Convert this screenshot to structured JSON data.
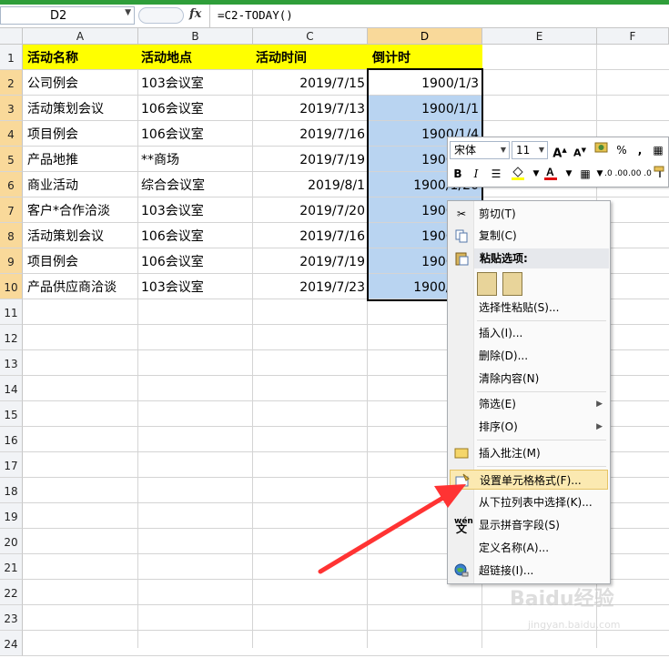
{
  "formula_bar": {
    "name_box": "D2",
    "fx": "fx",
    "formula": "=C2-TODAY()"
  },
  "columns": [
    "A",
    "B",
    "C",
    "D",
    "E",
    "F"
  ],
  "rows": [
    "1",
    "2",
    "3",
    "4",
    "5",
    "6",
    "7",
    "8",
    "9",
    "10",
    "11",
    "12",
    "13",
    "14",
    "15",
    "16",
    "17",
    "18",
    "19",
    "20",
    "21",
    "22",
    "23",
    "24"
  ],
  "headers": [
    "活动名称",
    "活动地点",
    "活动时间",
    "倒计时"
  ],
  "table": [
    [
      "公司例会",
      "103会议室",
      "2019/7/15",
      "1900/1/3"
    ],
    [
      "活动策划会议",
      "106会议室",
      "2019/7/13",
      "1900/1/1"
    ],
    [
      "项目例会",
      "106会议室",
      "2019/7/16",
      "1900/1/4"
    ],
    [
      "产品地推",
      "**商场",
      "2019/7/19",
      "1900/1/7"
    ],
    [
      "商业活动",
      "综合会议室",
      "2019/8/1",
      "1900/1/20"
    ],
    [
      "客户*合作洽淡",
      "103会议室",
      "2019/7/20",
      "1900/1/8"
    ],
    [
      "活动策划会议",
      "106会议室",
      "2019/7/16",
      "1900/1/4"
    ],
    [
      "项目例会",
      "106会议室",
      "2019/7/19",
      "1900/1/7"
    ],
    [
      "产品供应商洽谈",
      "103会议室",
      "2019/7/23",
      "1900/1/11"
    ]
  ],
  "mini_toolbar": {
    "font": "宋体",
    "size": "11",
    "bold": "B",
    "italic": "I",
    "currency": "$",
    "percent": "%",
    "comma": ",",
    "dec_inc": ".0 .00",
    "dec_dec": ".00 .0"
  },
  "context_menu": {
    "cut": "剪切(T)",
    "copy": "复制(C)",
    "paste_options": "粘贴选项:",
    "paste_special": "选择性粘贴(S)...",
    "insert": "插入(I)...",
    "delete": "删除(D)...",
    "clear": "清除内容(N)",
    "filter": "筛选(E)",
    "sort": "排序(O)",
    "insert_comment": "插入批注(M)",
    "format_cells": "设置单元格格式(F)...",
    "pick_list": "从下拉列表中选择(K)...",
    "phonetic": "显示拼音字段(S)",
    "define_name": "定义名称(A)...",
    "hyperlink": "超链接(I)..."
  },
  "colors": {
    "header_fill": "#ffff00",
    "selection": "#b9d4f1",
    "arrow": "#ff3333",
    "menu_highlight": "#fbe9b1"
  },
  "watermark": {
    "text": "Baidu经验",
    "sub": "jingyan.baidu.com"
  }
}
